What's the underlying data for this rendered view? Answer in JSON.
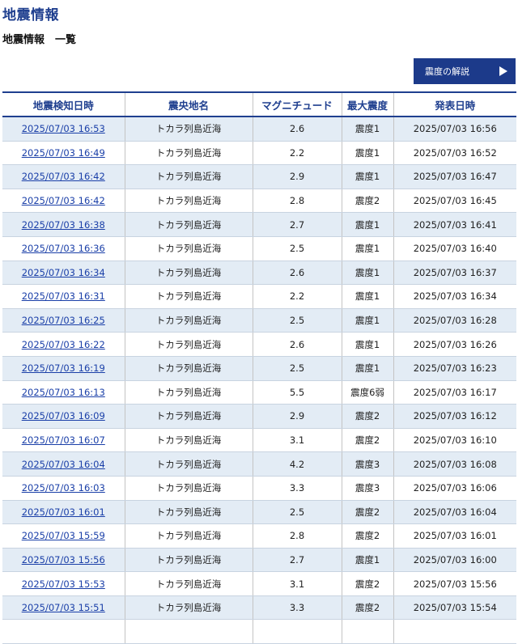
{
  "header": {
    "title": "地震情報",
    "subtitle": "地震情報　一覧"
  },
  "guide_button": {
    "label": "震度の解説",
    "icon": "play-triangle-icon"
  },
  "table": {
    "columns": [
      "地震検知日時",
      "震央地名",
      "マグニチュード",
      "最大震度",
      "発表日時"
    ],
    "rows": [
      {
        "detected": "2025/07/03 16:53",
        "epicenter": "トカラ列島近海",
        "magnitude": "2.6",
        "intensity": "震度1",
        "announced": "2025/07/03 16:56"
      },
      {
        "detected": "2025/07/03 16:49",
        "epicenter": "トカラ列島近海",
        "magnitude": "2.2",
        "intensity": "震度1",
        "announced": "2025/07/03 16:52"
      },
      {
        "detected": "2025/07/03 16:42",
        "epicenter": "トカラ列島近海",
        "magnitude": "2.9",
        "intensity": "震度1",
        "announced": "2025/07/03 16:47"
      },
      {
        "detected": "2025/07/03 16:42",
        "epicenter": "トカラ列島近海",
        "magnitude": "2.8",
        "intensity": "震度2",
        "announced": "2025/07/03 16:45"
      },
      {
        "detected": "2025/07/03 16:38",
        "epicenter": "トカラ列島近海",
        "magnitude": "2.7",
        "intensity": "震度1",
        "announced": "2025/07/03 16:41"
      },
      {
        "detected": "2025/07/03 16:36",
        "epicenter": "トカラ列島近海",
        "magnitude": "2.5",
        "intensity": "震度1",
        "announced": "2025/07/03 16:40"
      },
      {
        "detected": "2025/07/03 16:34",
        "epicenter": "トカラ列島近海",
        "magnitude": "2.6",
        "intensity": "震度1",
        "announced": "2025/07/03 16:37"
      },
      {
        "detected": "2025/07/03 16:31",
        "epicenter": "トカラ列島近海",
        "magnitude": "2.2",
        "intensity": "震度1",
        "announced": "2025/07/03 16:34"
      },
      {
        "detected": "2025/07/03 16:25",
        "epicenter": "トカラ列島近海",
        "magnitude": "2.5",
        "intensity": "震度1",
        "announced": "2025/07/03 16:28"
      },
      {
        "detected": "2025/07/03 16:22",
        "epicenter": "トカラ列島近海",
        "magnitude": "2.6",
        "intensity": "震度1",
        "announced": "2025/07/03 16:26"
      },
      {
        "detected": "2025/07/03 16:19",
        "epicenter": "トカラ列島近海",
        "magnitude": "2.5",
        "intensity": "震度1",
        "announced": "2025/07/03 16:23"
      },
      {
        "detected": "2025/07/03 16:13",
        "epicenter": "トカラ列島近海",
        "magnitude": "5.5",
        "intensity": "震度6弱",
        "announced": "2025/07/03 16:17"
      },
      {
        "detected": "2025/07/03 16:09",
        "epicenter": "トカラ列島近海",
        "magnitude": "2.9",
        "intensity": "震度2",
        "announced": "2025/07/03 16:12"
      },
      {
        "detected": "2025/07/03 16:07",
        "epicenter": "トカラ列島近海",
        "magnitude": "3.1",
        "intensity": "震度2",
        "announced": "2025/07/03 16:10"
      },
      {
        "detected": "2025/07/03 16:04",
        "epicenter": "トカラ列島近海",
        "magnitude": "4.2",
        "intensity": "震度3",
        "announced": "2025/07/03 16:08"
      },
      {
        "detected": "2025/07/03 16:03",
        "epicenter": "トカラ列島近海",
        "magnitude": "3.3",
        "intensity": "震度3",
        "announced": "2025/07/03 16:06"
      },
      {
        "detected": "2025/07/03 16:01",
        "epicenter": "トカラ列島近海",
        "magnitude": "2.5",
        "intensity": "震度2",
        "announced": "2025/07/03 16:04"
      },
      {
        "detected": "2025/07/03 15:59",
        "epicenter": "トカラ列島近海",
        "magnitude": "2.8",
        "intensity": "震度2",
        "announced": "2025/07/03 16:01"
      },
      {
        "detected": "2025/07/03 15:56",
        "epicenter": "トカラ列島近海",
        "magnitude": "2.7",
        "intensity": "震度1",
        "announced": "2025/07/03 16:00"
      },
      {
        "detected": "2025/07/03 15:53",
        "epicenter": "トカラ列島近海",
        "magnitude": "3.1",
        "intensity": "震度2",
        "announced": "2025/07/03 15:56"
      },
      {
        "detected": "2025/07/03 15:51",
        "epicenter": "トカラ列島近海",
        "magnitude": "3.3",
        "intensity": "震度2",
        "announced": "2025/07/03 15:54"
      },
      {
        "detected": "",
        "epicenter": "",
        "magnitude": "",
        "intensity": "",
        "announced": ""
      }
    ]
  },
  "colors": {
    "accent": "#1f3f8f",
    "button_bg": "#1c3a8a",
    "link": "#1a3fa8",
    "row_stripe": "#e3ecf5"
  }
}
